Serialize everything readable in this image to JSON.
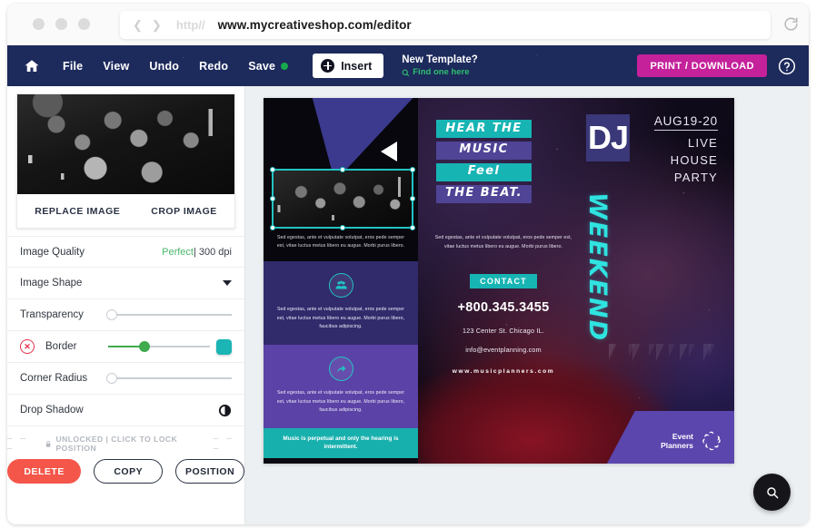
{
  "browser": {
    "url": "www.mycreativeshop.com/editor",
    "scheme_chip": "http//",
    "back_icon": "chevron-left-icon",
    "forward_icon": "chevron-right-icon",
    "reload_icon": "reload-icon"
  },
  "toolbar": {
    "home_icon": "home-icon",
    "items": [
      {
        "label": "File"
      },
      {
        "label": "View"
      },
      {
        "label": "Undo"
      },
      {
        "label": "Redo"
      }
    ],
    "save_label": "Save",
    "save_status_color": "#17a94b",
    "insert_label": "Insert",
    "new_template_title": "New Template?",
    "new_template_link": "Find one here",
    "print_label": "PRINT / DOWNLOAD",
    "print_color": "#c4219b",
    "help_icon": "help-circle-icon",
    "bg_color": "#1d2a5c"
  },
  "sidebar": {
    "image_actions": {
      "replace": "REPLACE IMAGE",
      "crop": "CROP IMAGE"
    },
    "rows": {
      "image_quality": {
        "label": "Image Quality",
        "value_good": "Perfect",
        "value_rest": " | 300 dpi"
      },
      "image_shape": {
        "label": "Image Shape"
      },
      "transparency": {
        "label": "Transparency",
        "value": 0
      },
      "border": {
        "label": "Border",
        "value": 28,
        "swatch_color": "#1bb5b5"
      },
      "corner_radius": {
        "label": "Corner Radius",
        "value": 0
      },
      "drop_shadow": {
        "label": "Drop Shadow"
      }
    },
    "lock_text": "UNLOCKED | CLICK TO LOCK POSITION",
    "lock_dashes": "– – –",
    "buttons": {
      "delete": "DELETE",
      "copy": "COPY",
      "position": "POSITION"
    }
  },
  "flyer": {
    "panel1": {
      "caption": "Sed egestas, ante et vulputate volutpat, eros pede semper est, vitae luctus metus libero eu augue. Morbi purus libero.",
      "block1": {
        "icon": "group-people-icon",
        "body": "Sed egestas, ante et vulputate volutpat, eros pede semper est, vitae luctus metus libero eu augue. Morbi purus libero, faucibus adipiscing."
      },
      "block2": {
        "icon": "share-arrow-icon",
        "body": "Sed egestas, ante et vulputate volutpat, eros pede semper est, vitae luctus metus libero eu augue. Morbi purus libero, faucibus adipiscing."
      },
      "footer": "Music is perpetual and only the hearing is intermittent."
    },
    "panel2": {
      "slogan": [
        {
          "text": "HEAR THE",
          "style": "teal"
        },
        {
          "text": "MUSIC",
          "style": "purple"
        },
        {
          "text": "Feel",
          "style": "teal"
        },
        {
          "text": "THE BEAT.",
          "style": "purple"
        }
      ],
      "dj": "DJ",
      "date": "AUG19-20",
      "event_lines": [
        "LIVE",
        "HOUSE",
        "PARTY"
      ],
      "weekend": "WEEKEND",
      "body": "Sed egestas, ante et vulputate volutpat, eros pede semper est, vitae luctus metus libero eu augue. Morbi purus libero.",
      "contact_chip": "CONTACT",
      "phone": "+800.345.3455",
      "address": "123 Center St. Chicago IL.",
      "email": "info@eventplanning.com",
      "website": "www.musicplanners.com",
      "logo_line1": "Event",
      "logo_line2": "Planners",
      "logo_icon": "swirl-logo-icon"
    }
  },
  "zoom_fab": {
    "icon": "magnifier-icon"
  }
}
